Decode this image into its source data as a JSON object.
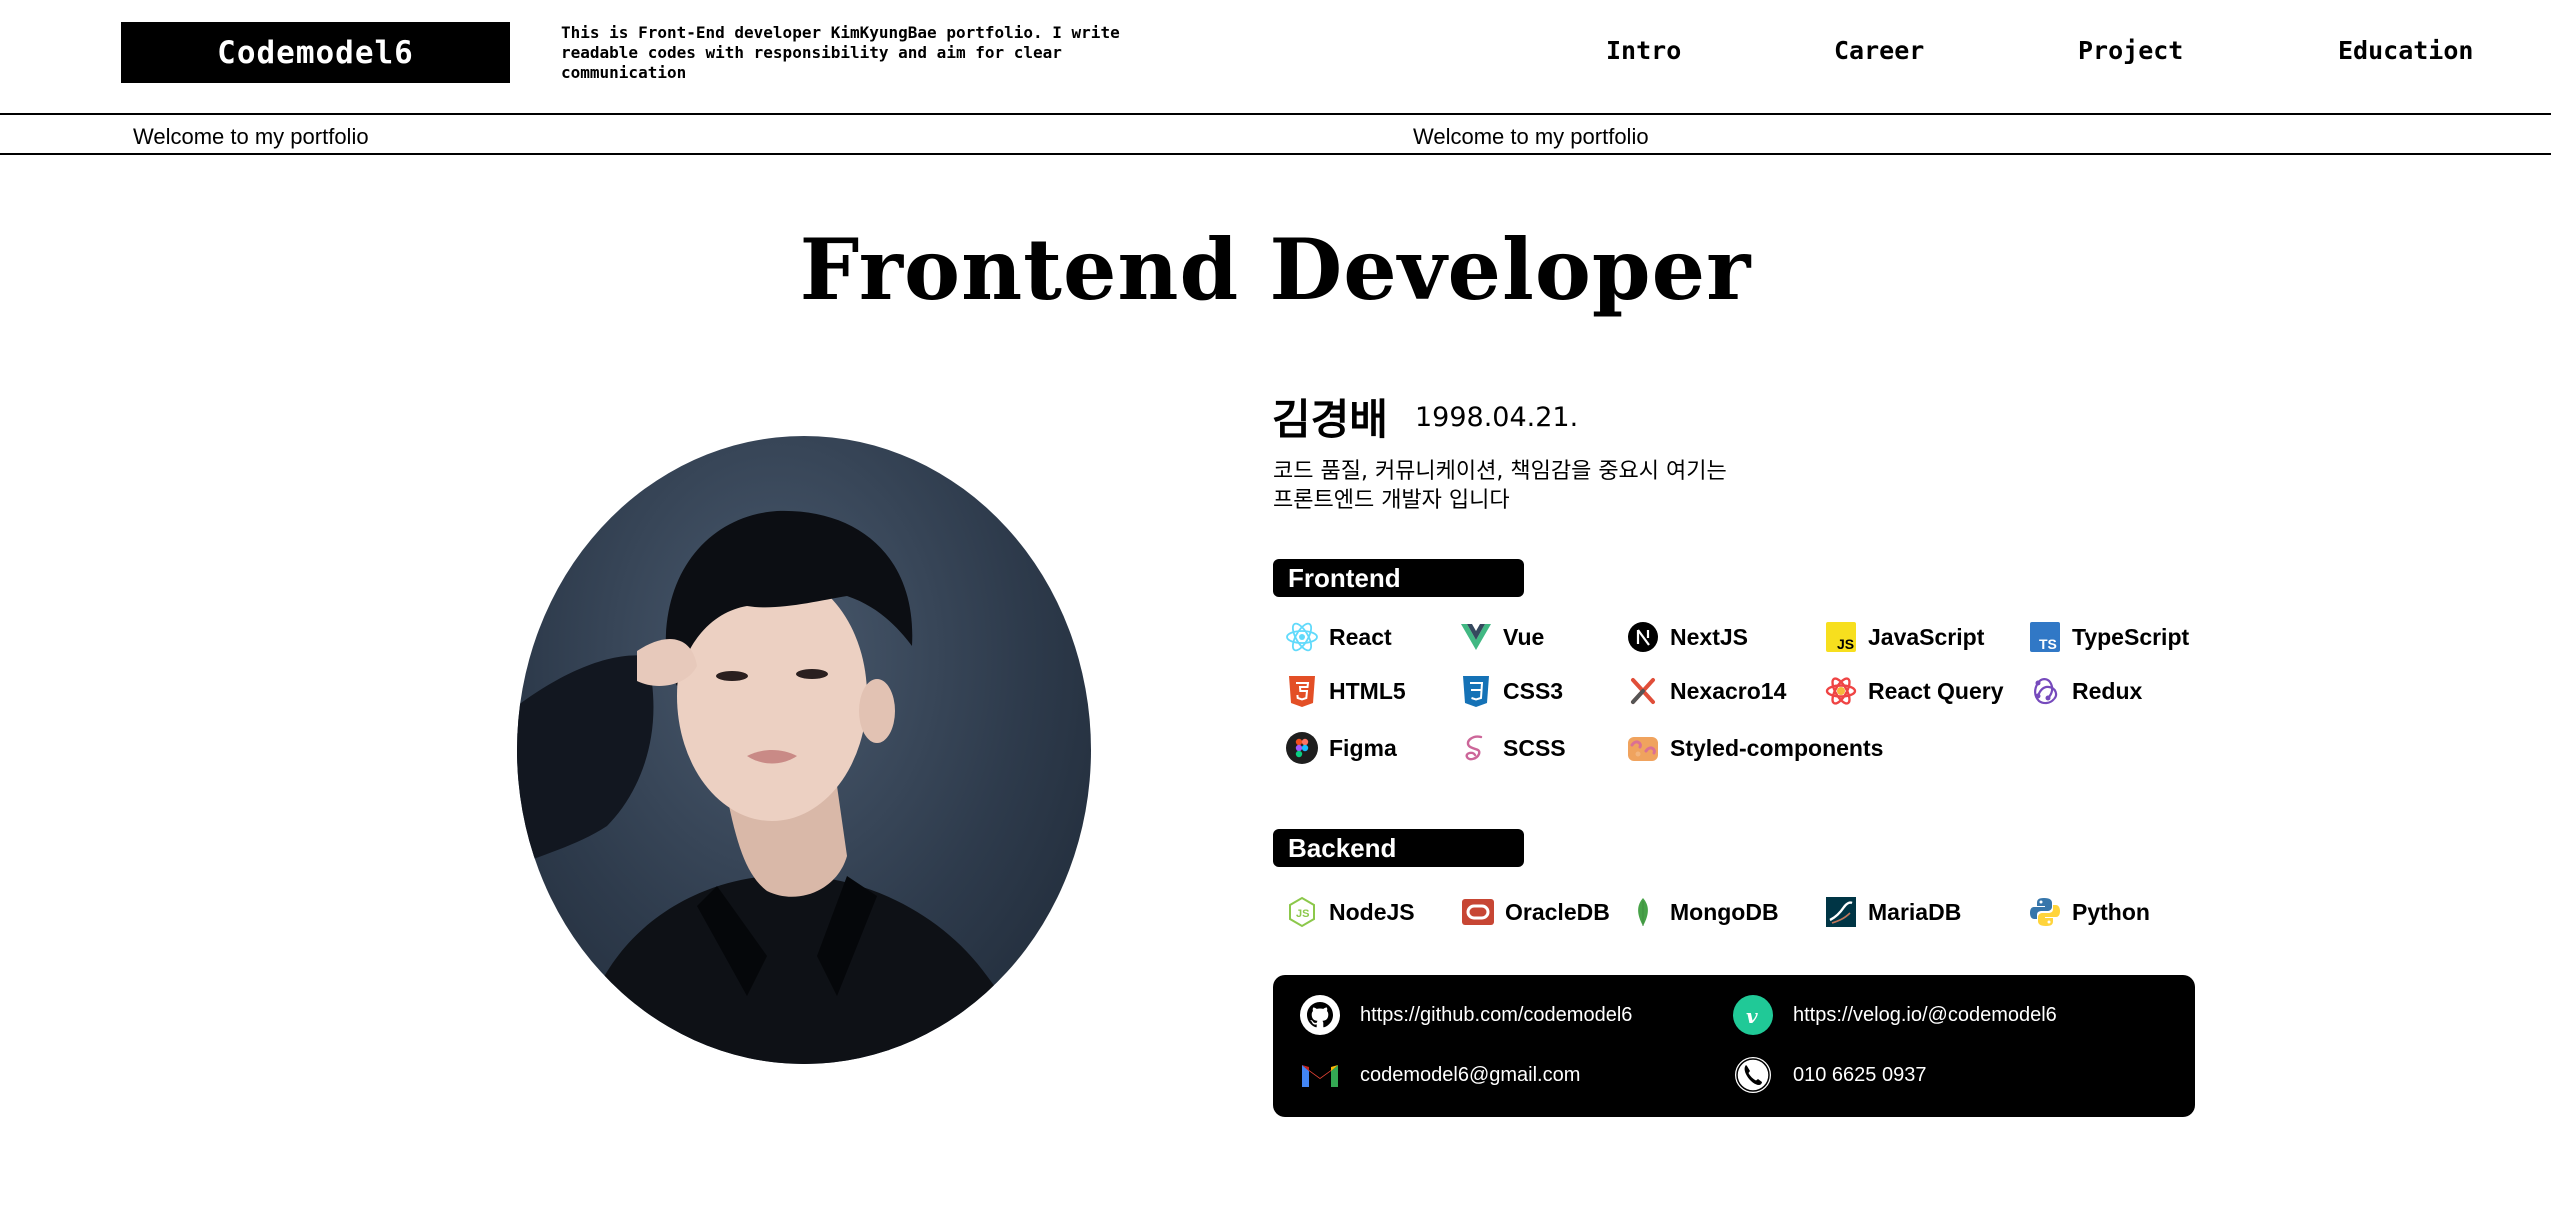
{
  "header": {
    "logo": "Codemodel6",
    "tagline": "This is Front-End developer KimKyungBae portfolio. I write readable codes with responsibility and aim for clear communication",
    "nav": [
      "Intro",
      "Career",
      "Project",
      "Education"
    ]
  },
  "marquee": {
    "text1": "Welcome to my portfolio",
    "text2": "Welcome to my portfolio"
  },
  "hero": {
    "title": "Frontend Developer"
  },
  "profile": {
    "name": "김경배",
    "birth": "1998.04.21.",
    "intro_line1": "코드 품질, 커뮤니케이션, 책임감을 중요시 여기는",
    "intro_line2": "프론트엔드 개발자 입니다"
  },
  "frontend": {
    "label": "Frontend",
    "items": [
      {
        "name": "React",
        "icon": "react-icon",
        "color": "#61dafb"
      },
      {
        "name": "Vue",
        "icon": "vue-icon",
        "color": "#41b883"
      },
      {
        "name": "NextJS",
        "icon": "nextjs-icon",
        "color": "#000000"
      },
      {
        "name": "JavaScript",
        "icon": "javascript-icon",
        "color": "#f7df1e"
      },
      {
        "name": "TypeScript",
        "icon": "typescript-icon",
        "color": "#3178c6"
      },
      {
        "name": "HTML5",
        "icon": "html5-icon",
        "color": "#e34f26"
      },
      {
        "name": "CSS3",
        "icon": "css3-icon",
        "color": "#1572b6"
      },
      {
        "name": "Nexacro14",
        "icon": "nexacro-icon",
        "color": "#e04e39"
      },
      {
        "name": "React Query",
        "icon": "react-query-icon",
        "color": "#ef4444"
      },
      {
        "name": "Redux",
        "icon": "redux-icon",
        "color": "#764abc"
      },
      {
        "name": "Figma",
        "icon": "figma-icon",
        "color": "#1e1e1e"
      },
      {
        "name": "SCSS",
        "icon": "scss-icon",
        "color": "#cc6699"
      },
      {
        "name": "Styled-components",
        "icon": "styled-components-icon",
        "color": "#db7093"
      }
    ]
  },
  "backend": {
    "label": "Backend",
    "items": [
      {
        "name": "NodeJS",
        "icon": "nodejs-icon",
        "color": "#8cc84b"
      },
      {
        "name": "OracleDB",
        "icon": "oracle-icon",
        "color": "#c74634"
      },
      {
        "name": "MongoDB",
        "icon": "mongodb-icon",
        "color": "#47a248"
      },
      {
        "name": "MariaDB",
        "icon": "mariadb-icon",
        "color": "#003545"
      },
      {
        "name": "Python",
        "icon": "python-icon",
        "color": "#3776ab"
      }
    ]
  },
  "contact": {
    "github": "https://github.com/codemodel6",
    "velog": "https://velog.io/@codemodel6",
    "email": "codemodel6@gmail.com",
    "phone": "010 6625 0937"
  }
}
